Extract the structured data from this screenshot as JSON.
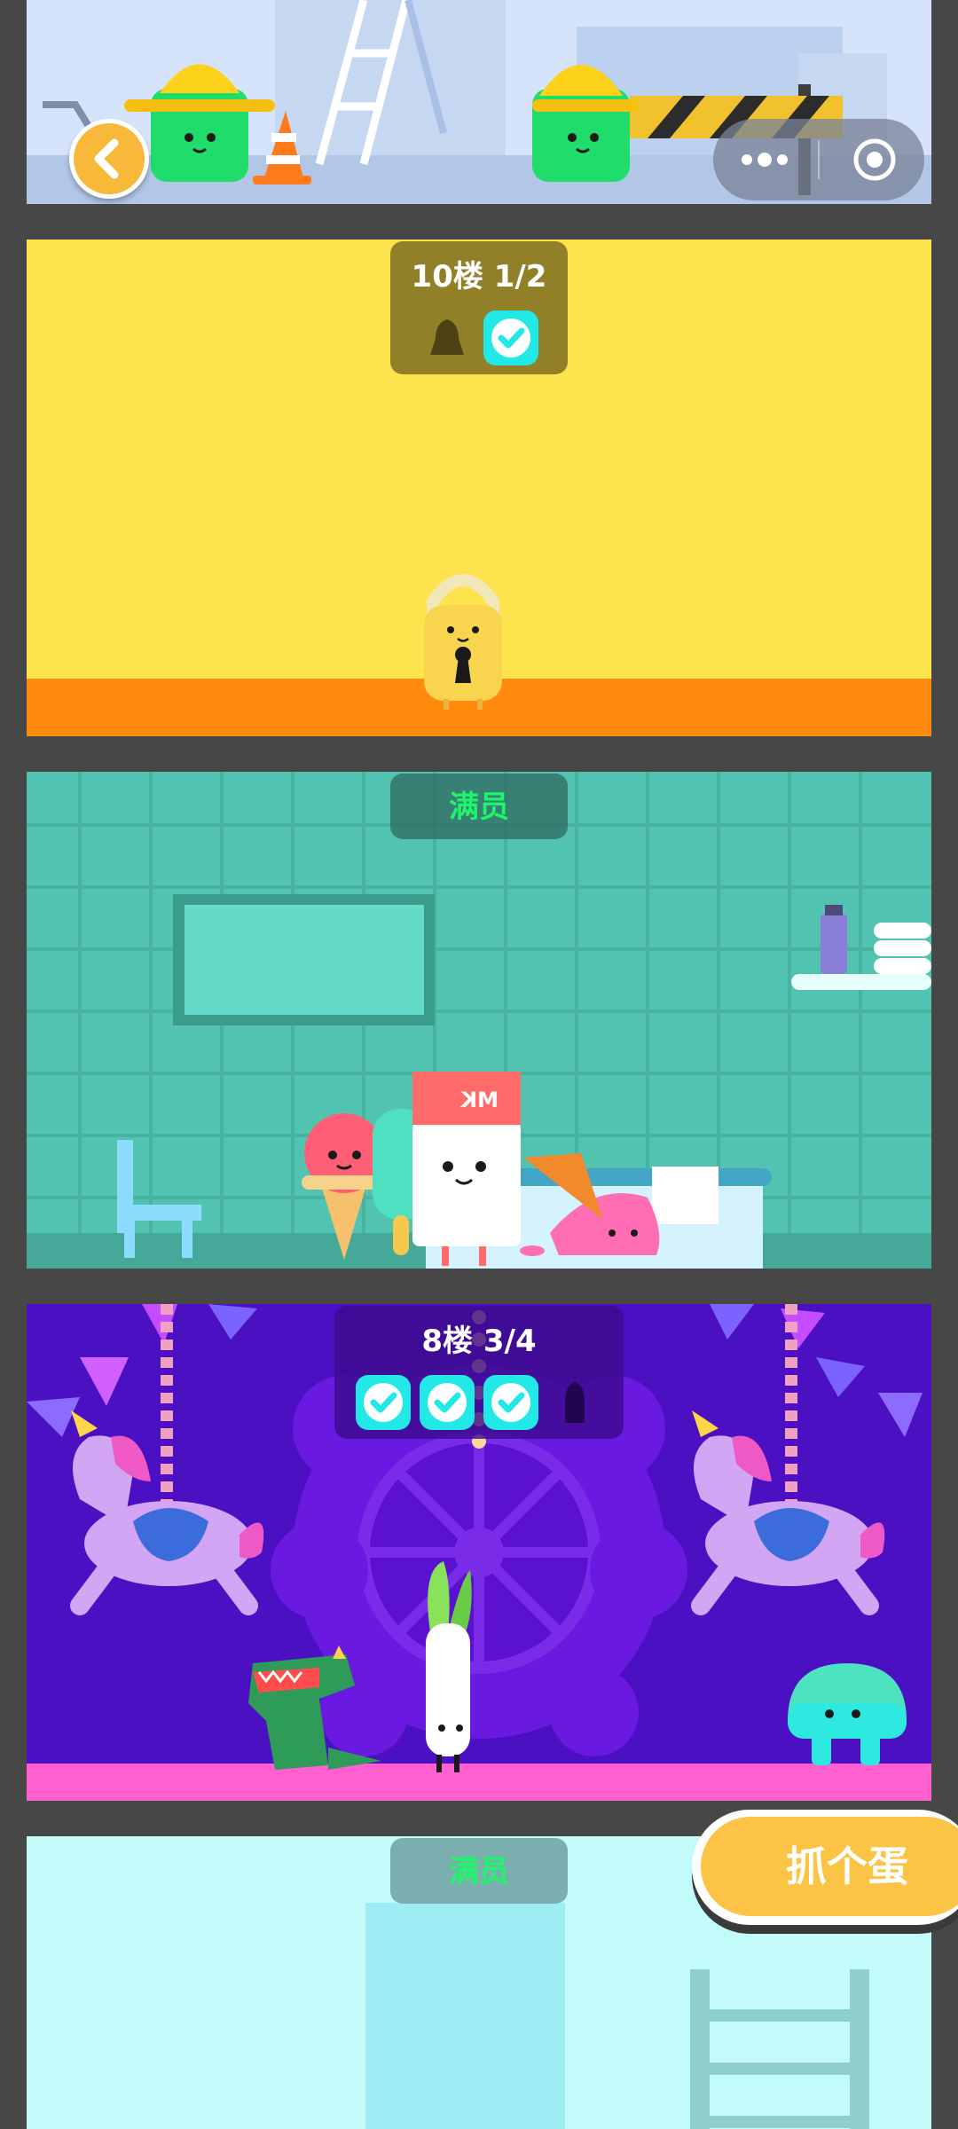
{
  "top_controls": {
    "back_icon": "chevron-left-icon",
    "more_icon": "more-dots-icon",
    "close_icon": "target-circle-icon"
  },
  "floors": [
    {
      "id": "floor-10",
      "label": "10楼 1/2",
      "slots": [
        "empty",
        "done"
      ],
      "locked": true,
      "bg": "#fde34e",
      "floor_color": "#ff8a0b"
    },
    {
      "id": "floor-9",
      "label": "满员",
      "bg": "#52c3b0"
    },
    {
      "id": "floor-8",
      "label": "8楼 3/4",
      "slots": [
        "done",
        "done",
        "done",
        "empty"
      ],
      "bg": "#4b10c2",
      "floor_color": "#ff5fcf"
    },
    {
      "id": "floor-7",
      "label": "满员",
      "bg": "#c3fbfb"
    }
  ],
  "catch_button": {
    "label": "抓个蛋"
  },
  "colors": {
    "accent": "#f8b93b",
    "full_text": "#1ef56a",
    "check_fill": "#23e9e6"
  }
}
